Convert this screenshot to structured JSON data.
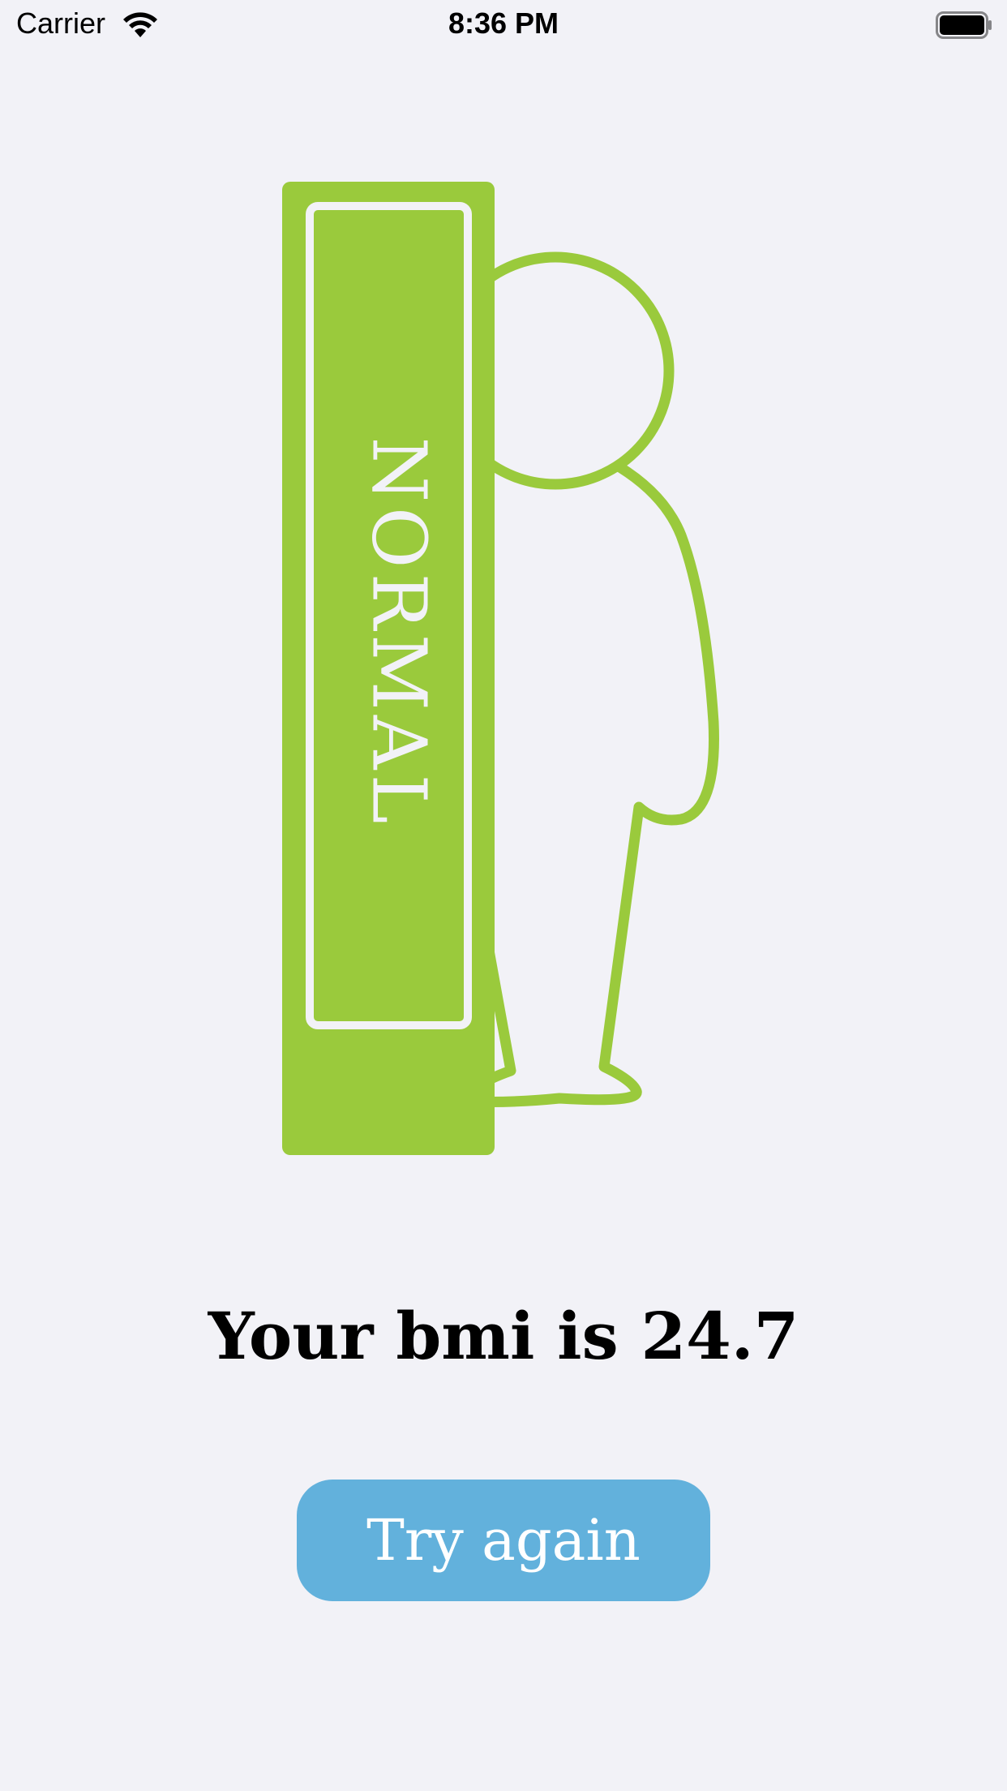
{
  "status_bar": {
    "carrier": "Carrier",
    "time": "8:36 PM"
  },
  "illustration": {
    "category_label": "NORMAL",
    "accent_color": "#9aca3c"
  },
  "result": {
    "bmi_text": "Your bmi is 24.7"
  },
  "actions": {
    "try_again_label": "Try again",
    "button_color": "#62b1dc"
  }
}
